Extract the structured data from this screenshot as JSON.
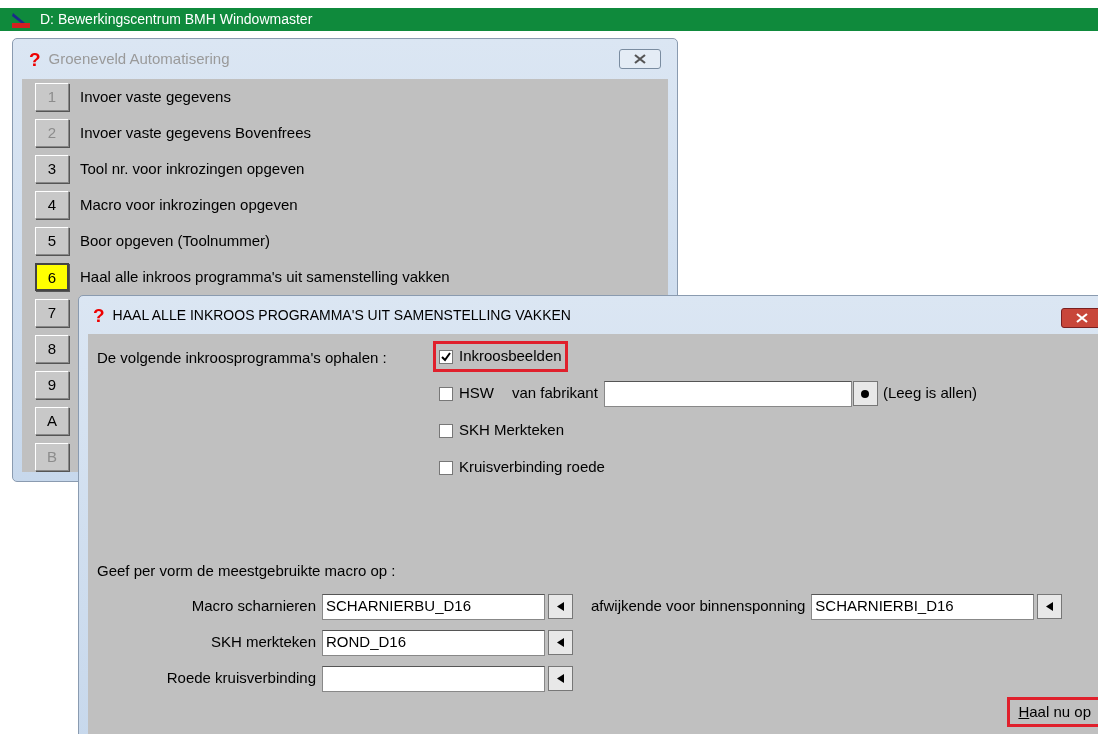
{
  "app_title": "D: Bewerkingscentrum BMH Windowmaster",
  "menu_window": {
    "help_mark": "?",
    "title": "Groeneveld Automatisering",
    "items": [
      {
        "key": "1",
        "label": "Invoer vaste gegevens",
        "disabled": true,
        "selected": false
      },
      {
        "key": "2",
        "label": "Invoer vaste gegevens Bovenfrees",
        "disabled": true,
        "selected": false
      },
      {
        "key": "3",
        "label": "Tool nr. voor inkrozingen opgeven",
        "disabled": false,
        "selected": false
      },
      {
        "key": "4",
        "label": "Macro voor inkrozingen opgeven",
        "disabled": false,
        "selected": false
      },
      {
        "key": "5",
        "label": "Boor opgeven (Toolnummer)",
        "disabled": false,
        "selected": false
      },
      {
        "key": "6",
        "label": "Haal alle inkroos programma's uit samenstelling vakken",
        "disabled": false,
        "selected": true
      },
      {
        "key": "7",
        "disabled": false,
        "selected": false
      },
      {
        "key": "8",
        "disabled": false,
        "selected": false
      },
      {
        "key": "9",
        "disabled": false,
        "selected": false
      },
      {
        "key": "A",
        "disabled": false,
        "selected": false
      },
      {
        "key": "B",
        "disabled": true,
        "selected": false
      }
    ]
  },
  "dialog": {
    "help_mark": "?",
    "title": "HAAL ALLE INKROOS PROGRAMMA'S UIT SAMENSTELLING VAKKEN",
    "intro": "De volgende inkroosprogramma's ophalen :",
    "options": [
      {
        "label": "Inkroosbeelden",
        "checked": true,
        "highlighted": true
      },
      {
        "label": "HSW",
        "checked": false,
        "highlighted": false,
        "manufacturer": {
          "label": "van fabrikant",
          "hint": "(Leeg is allen)"
        }
      },
      {
        "label": "SKH Merkteken",
        "checked": false,
        "highlighted": false
      },
      {
        "label": "Kruisverbinding roede",
        "checked": false,
        "highlighted": false
      }
    ],
    "macro_heading": "Geef per vorm de meestgebruikte macro op :",
    "macro_fields": [
      {
        "label": "Macro scharnieren",
        "value": "SCHARNIERBU_D16",
        "alt": {
          "label": "afwijkende voor binnensponning",
          "value": "SCHARNIERBI_D16"
        }
      },
      {
        "label": "SKH merkteken",
        "value": "ROND_D16"
      },
      {
        "label": "Roede kruisverbinding"
      }
    ],
    "submit": {
      "access_key": "H",
      "label_rest": "aal nu op",
      "highlighted": true
    }
  }
}
